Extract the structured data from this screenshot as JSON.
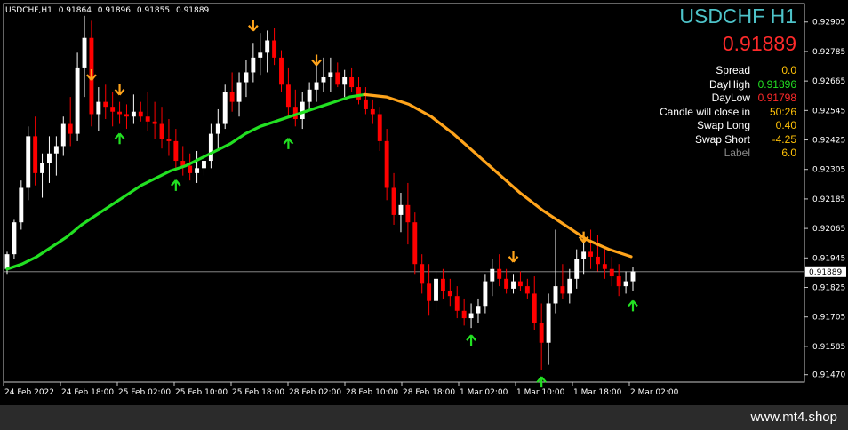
{
  "header": {
    "symbol": "USDCHF,H1",
    "open": "0.91864",
    "high": "0.91896",
    "low": "0.91855",
    "close": "0.91889"
  },
  "overlay": {
    "title": "USDCHF H1",
    "price": "0.91889",
    "rows": [
      {
        "label": "Spread",
        "value": "0.0",
        "value_color": "#ffc107"
      },
      {
        "label": "DayHigh",
        "value": "0.91896",
        "value_color": "#22e022"
      },
      {
        "label": "DayLow",
        "value": "0.91798",
        "value_color": "#ff2a2a"
      },
      {
        "label": "Candle will close in",
        "value": "50:26",
        "value_color": "#ffc107"
      },
      {
        "label": "Swap Long",
        "value": "0.40",
        "value_color": "#ffc107"
      },
      {
        "label": "Swap Short",
        "value": "-4.25",
        "value_color": "#ffc107"
      },
      {
        "label": "Label",
        "value": "6.0",
        "value_color": "#ffc107"
      }
    ]
  },
  "watermark": "www.mt4.shop",
  "chart_data": {
    "type": "candlestick",
    "ylim": [
      0.9144,
      0.9298
    ],
    "y_ticks": [
      "0.92905",
      "0.92785",
      "0.92665",
      "0.92545",
      "0.92425",
      "0.92305",
      "0.92185",
      "0.92065",
      "0.91945",
      "0.91825",
      "0.91705",
      "0.91585",
      "0.91470"
    ],
    "current_price": "0.91889",
    "x_ticks": [
      "24 Feb 2022",
      "24 Feb 18:00",
      "25 Feb 02:00",
      "25 Feb 10:00",
      "25 Feb 18:00",
      "28 Feb 02:00",
      "28 Feb 10:00",
      "28 Feb 18:00",
      "1 Mar 02:00",
      "1 Mar 10:00",
      "1 Mar 18:00",
      "2 Mar 02:00"
    ],
    "candles": [
      [
        0.919,
        0.9197,
        0.9188,
        0.9196
      ],
      [
        0.9196,
        0.921,
        0.9194,
        0.9209
      ],
      [
        0.9209,
        0.9226,
        0.9206,
        0.9223
      ],
      [
        0.9223,
        0.9248,
        0.9218,
        0.9244
      ],
      [
        0.9244,
        0.9252,
        0.9224,
        0.9229
      ],
      [
        0.9229,
        0.9237,
        0.9219,
        0.9233
      ],
      [
        0.9233,
        0.9244,
        0.9225,
        0.9237
      ],
      [
        0.9237,
        0.9244,
        0.9228,
        0.924
      ],
      [
        0.924,
        0.9252,
        0.9236,
        0.9249
      ],
      [
        0.9249,
        0.926,
        0.924,
        0.9245
      ],
      [
        0.9245,
        0.9278,
        0.9242,
        0.9272
      ],
      [
        0.9272,
        0.9293,
        0.926,
        0.9284
      ],
      [
        0.9284,
        0.9291,
        0.9248,
        0.9253
      ],
      [
        0.9253,
        0.9264,
        0.9246,
        0.9258
      ],
      [
        0.9258,
        0.9265,
        0.9251,
        0.9256
      ],
      [
        0.9256,
        0.9262,
        0.9248,
        0.9254
      ],
      [
        0.9254,
        0.9258,
        0.9249,
        0.9253
      ],
      [
        0.9253,
        0.9257,
        0.9247,
        0.9252
      ],
      [
        0.9252,
        0.9261,
        0.9249,
        0.9254
      ],
      [
        0.9254,
        0.9258,
        0.925,
        0.9252
      ],
      [
        0.9252,
        0.9262,
        0.9246,
        0.925
      ],
      [
        0.925,
        0.9258,
        0.9243,
        0.9249
      ],
      [
        0.9249,
        0.9256,
        0.9239,
        0.9243
      ],
      [
        0.9243,
        0.9251,
        0.9236,
        0.9242
      ],
      [
        0.9242,
        0.9247,
        0.923,
        0.9234
      ],
      [
        0.9234,
        0.924,
        0.9228,
        0.9232
      ],
      [
        0.9232,
        0.9237,
        0.9226,
        0.9229
      ],
      [
        0.9229,
        0.9238,
        0.9225,
        0.9231
      ],
      [
        0.9231,
        0.9237,
        0.9228,
        0.9234
      ],
      [
        0.9234,
        0.9249,
        0.9231,
        0.9245
      ],
      [
        0.9245,
        0.9255,
        0.9238,
        0.9249
      ],
      [
        0.9249,
        0.9265,
        0.9247,
        0.9262
      ],
      [
        0.9262,
        0.927,
        0.9254,
        0.9258
      ],
      [
        0.9258,
        0.927,
        0.9252,
        0.9266
      ],
      [
        0.9266,
        0.9275,
        0.926,
        0.927
      ],
      [
        0.927,
        0.9282,
        0.9266,
        0.9276
      ],
      [
        0.9276,
        0.9286,
        0.9269,
        0.9278
      ],
      [
        0.9278,
        0.9287,
        0.927,
        0.9283
      ],
      [
        0.9283,
        0.9288,
        0.9273,
        0.9276
      ],
      [
        0.9276,
        0.9279,
        0.9262,
        0.9265
      ],
      [
        0.9265,
        0.9272,
        0.9252,
        0.9256
      ],
      [
        0.9256,
        0.9263,
        0.9248,
        0.9251
      ],
      [
        0.9251,
        0.9262,
        0.9247,
        0.9258
      ],
      [
        0.9258,
        0.9266,
        0.9255,
        0.9263
      ],
      [
        0.9263,
        0.9274,
        0.9258,
        0.9266
      ],
      [
        0.9266,
        0.9276,
        0.9262,
        0.9268
      ],
      [
        0.9268,
        0.9276,
        0.9262,
        0.927
      ],
      [
        0.927,
        0.9274,
        0.9264,
        0.9265
      ],
      [
        0.9265,
        0.9271,
        0.926,
        0.9268
      ],
      [
        0.9268,
        0.9272,
        0.9262,
        0.9264
      ],
      [
        0.9264,
        0.9268,
        0.9257,
        0.9259
      ],
      [
        0.9259,
        0.9264,
        0.9253,
        0.9255
      ],
      [
        0.9255,
        0.9259,
        0.9249,
        0.9253
      ],
      [
        0.9253,
        0.9256,
        0.9238,
        0.9242
      ],
      [
        0.9242,
        0.9247,
        0.9218,
        0.9223
      ],
      [
        0.9223,
        0.9229,
        0.9208,
        0.9212
      ],
      [
        0.9212,
        0.9221,
        0.9205,
        0.9216
      ],
      [
        0.9216,
        0.9225,
        0.92,
        0.9209
      ],
      [
        0.9209,
        0.9213,
        0.9188,
        0.9192
      ],
      [
        0.9192,
        0.9196,
        0.918,
        0.9184
      ],
      [
        0.9184,
        0.9192,
        0.9171,
        0.9177
      ],
      [
        0.9177,
        0.9189,
        0.9173,
        0.9186
      ],
      [
        0.9186,
        0.919,
        0.9178,
        0.9181
      ],
      [
        0.9181,
        0.9186,
        0.9175,
        0.9179
      ],
      [
        0.9179,
        0.9183,
        0.917,
        0.9173
      ],
      [
        0.9173,
        0.9178,
        0.9167,
        0.917
      ],
      [
        0.917,
        0.9176,
        0.9166,
        0.9172
      ],
      [
        0.9172,
        0.9178,
        0.9168,
        0.9175
      ],
      [
        0.9175,
        0.9188,
        0.9172,
        0.9185
      ],
      [
        0.9185,
        0.9194,
        0.9179,
        0.919
      ],
      [
        0.919,
        0.9196,
        0.9183,
        0.9186
      ],
      [
        0.9186,
        0.919,
        0.918,
        0.9182
      ],
      [
        0.9182,
        0.9188,
        0.918,
        0.9185
      ],
      [
        0.9185,
        0.9189,
        0.9181,
        0.9183
      ],
      [
        0.9183,
        0.9186,
        0.9178,
        0.918
      ],
      [
        0.918,
        0.9187,
        0.9165,
        0.9168
      ],
      [
        0.9168,
        0.9176,
        0.9149,
        0.916
      ],
      [
        0.916,
        0.918,
        0.9151,
        0.9176
      ],
      [
        0.9176,
        0.9206,
        0.9172,
        0.9183
      ],
      [
        0.9183,
        0.9192,
        0.9178,
        0.918
      ],
      [
        0.918,
        0.919,
        0.9176,
        0.9186
      ],
      [
        0.9186,
        0.9198,
        0.9182,
        0.9194
      ],
      [
        0.9194,
        0.9203,
        0.9188,
        0.9197
      ],
      [
        0.9197,
        0.9206,
        0.919,
        0.9195
      ],
      [
        0.9195,
        0.9204,
        0.9189,
        0.9192
      ],
      [
        0.9192,
        0.9198,
        0.9186,
        0.919
      ],
      [
        0.919,
        0.9195,
        0.9183,
        0.9187
      ],
      [
        0.9187,
        0.9192,
        0.9179,
        0.9183
      ],
      [
        0.9183,
        0.9189,
        0.918,
        0.9185
      ],
      [
        0.9185,
        0.9191,
        0.9181,
        0.9189
      ]
    ],
    "ma_green": [
      0.919,
      0.9192,
      0.9195,
      0.9199,
      0.9203,
      0.9208,
      0.9212,
      0.9216,
      0.922,
      0.9224,
      0.9227,
      0.923,
      0.9232,
      0.9235,
      0.9238,
      0.9241,
      0.9245,
      0.9248,
      0.925,
      0.9252,
      0.9254,
      0.9256,
      0.9258,
      0.926,
      0.9261
    ],
    "ma_orange": [
      0.9261,
      0.926,
      0.9257,
      0.9252,
      0.9245,
      0.9237,
      0.9229,
      0.9221,
      0.9214,
      0.9208,
      0.9202,
      0.9198,
      0.9195
    ],
    "arrows_up": [
      [
        16,
        0.9248
      ],
      [
        24,
        0.9229
      ],
      [
        40,
        0.9246
      ],
      [
        66,
        0.9166
      ],
      [
        76,
        0.9149
      ],
      [
        89,
        0.918
      ]
    ],
    "arrows_down": [
      [
        12,
        0.9264
      ],
      [
        16,
        0.9258
      ],
      [
        35,
        0.9284
      ],
      [
        44,
        0.927
      ],
      [
        72,
        0.919
      ],
      [
        82,
        0.9198
      ]
    ]
  }
}
